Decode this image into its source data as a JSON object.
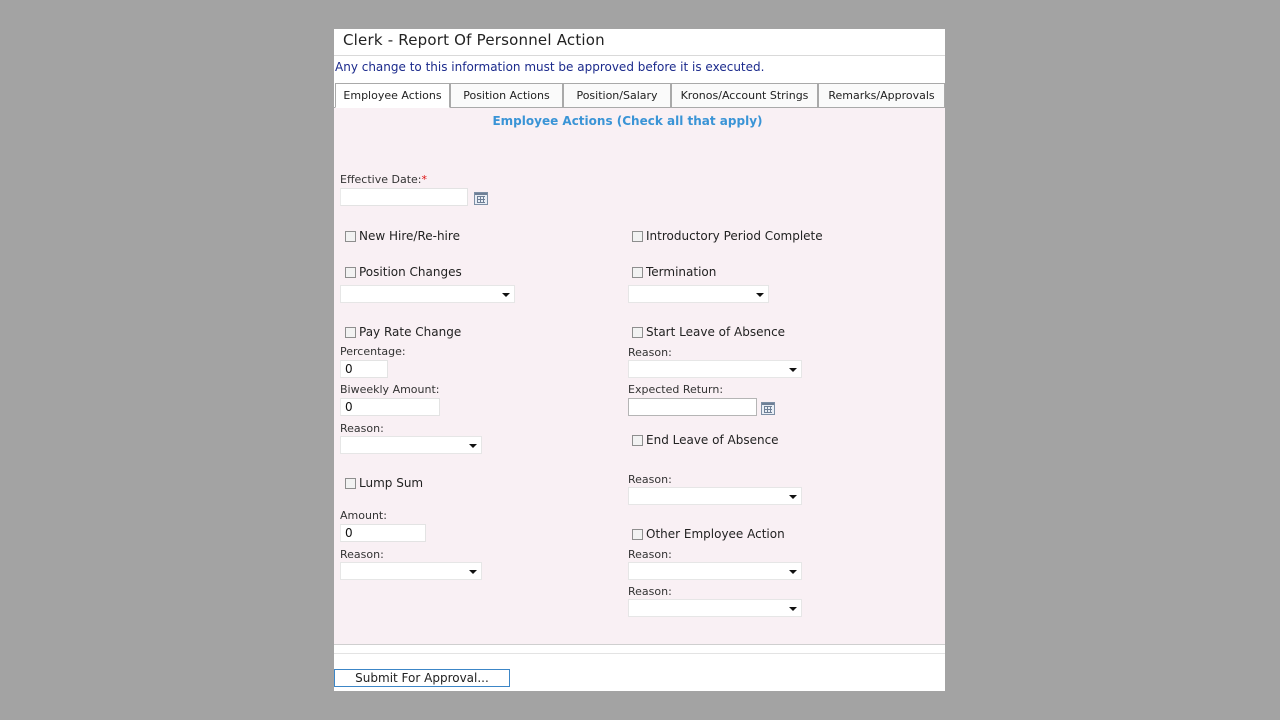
{
  "page": {
    "title": "Clerk - Report Of Personnel Action",
    "notice": "Any change to this information must be approved before it is executed."
  },
  "tabs": [
    {
      "label": "Employee Actions",
      "active": true
    },
    {
      "label": "Position Actions",
      "active": false
    },
    {
      "label": "Position/Salary",
      "active": false
    },
    {
      "label": "Kronos/Account Strings",
      "active": false
    },
    {
      "label": "Remarks/Approvals",
      "active": false
    }
  ],
  "section_title": "Employee Actions (Check all that apply)",
  "effective_date": {
    "label": "Effective Date:",
    "required_mark": "*",
    "value": ""
  },
  "left": {
    "new_hire": {
      "label": "New Hire/Re-hire",
      "checked": false
    },
    "position_changes": {
      "label": "Position Changes",
      "checked": false,
      "select_value": ""
    },
    "pay_rate_change": {
      "label": "Pay Rate Change",
      "checked": false,
      "percentage_label": "Percentage:",
      "percentage_value": "0",
      "biweekly_label": "Biweekly Amount:",
      "biweekly_value": "0",
      "reason_label": "Reason:",
      "reason_value": ""
    },
    "lump_sum": {
      "label": "Lump Sum",
      "checked": false,
      "amount_label": "Amount:",
      "amount_value": "0",
      "reason_label": "Reason:",
      "reason_value": ""
    }
  },
  "right": {
    "introductory": {
      "label": "Introductory Period Complete",
      "checked": false
    },
    "termination": {
      "label": "Termination",
      "checked": false,
      "select_value": ""
    },
    "start_leave": {
      "label": "Start Leave of Absence",
      "checked": false,
      "reason_label": "Reason:",
      "reason_value": "",
      "expected_return_label": "Expected Return:",
      "expected_return_value": ""
    },
    "end_leave": {
      "label": "End Leave of Absence",
      "checked": false,
      "reason_label": "Reason:",
      "reason_value": ""
    },
    "other_action": {
      "label": "Other Employee Action",
      "checked": false,
      "reason1_label": "Reason:",
      "reason1_value": "",
      "reason2_label": "Reason:",
      "reason2_value": ""
    }
  },
  "submit_label": "Submit For Approval..."
}
